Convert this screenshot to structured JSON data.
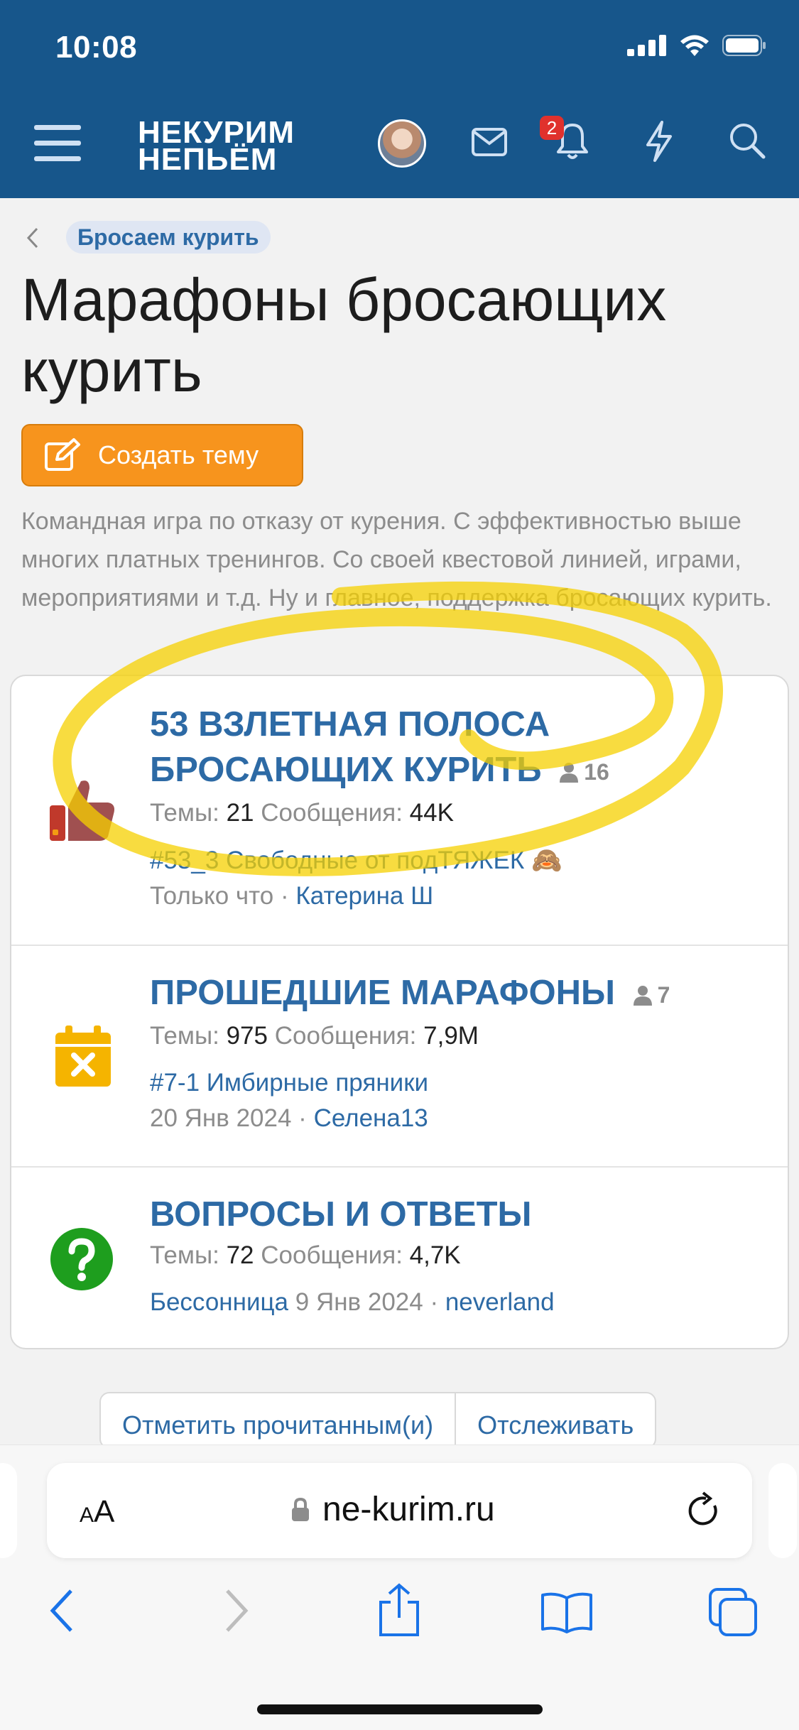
{
  "status": {
    "time": "10:08"
  },
  "header": {
    "logo_line1": "НЕКУРИМ",
    "logo_line2": "НЕПЬЁМ",
    "notifications_count": "2"
  },
  "breadcrumb": {
    "label": "Бросаем курить"
  },
  "page": {
    "title": "Марафоны бросающих курить",
    "create_button": "Создать тему",
    "description": "Командная игра по отказу от курения. С эффективностью выше многих платных тренингов. Со своей квестовой линией, играми, мероприятиями и т.д. Ну и главное, поддержка бросающих курить."
  },
  "labels": {
    "threads": "Темы:",
    "messages": "Сообщения:"
  },
  "nodes": [
    {
      "title": "53 ВЗЛЕТНАЯ ПОЛОСА БРОСАЮЩИХ КУРИТЬ",
      "members": "16",
      "threads": "21",
      "messages": "44K",
      "last_thread": "#53_3 Свободные от подТЯЖЕК 🙈",
      "last_time": "Только что ·",
      "last_user": "Катерина Ш",
      "icon": "thumbs-up-icon"
    },
    {
      "title": "ПРОШЕДШИЕ МАРАФОНЫ",
      "members": "7",
      "threads": "975",
      "messages": "7,9M",
      "last_thread": "#7-1 Имбирные пряники",
      "last_time": "20 Янв 2024 ·",
      "last_user": "Селена13",
      "icon": "calendar-x-icon"
    },
    {
      "title": "ВОПРОСЫ И ОТВЕТЫ",
      "threads": "72",
      "messages": "4,7K",
      "last_thread": "Бессонница",
      "last_time": "9 Янв 2024 ·",
      "last_user": "neverland",
      "icon": "question-icon"
    }
  ],
  "actions": {
    "mark_read": "Отметить прочитанным(и)",
    "watch": "Отслеживать"
  },
  "browser": {
    "aa_small": "A",
    "aa_big": "A",
    "url": "ne-kurim.ru"
  },
  "colors": {
    "header": "#17568b",
    "link": "#2d6aa5",
    "button": "#f7941d",
    "highlight": "#f5d000"
  }
}
